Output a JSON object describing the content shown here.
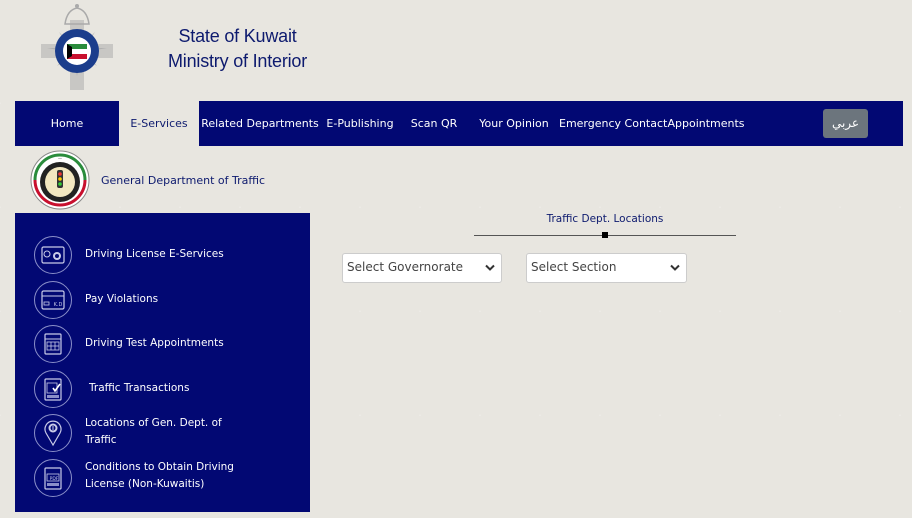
{
  "header": {
    "logo_alt": "Kuwait Police",
    "title_line1": "State of Kuwait",
    "title_line2": "Ministry of Interior"
  },
  "nav": {
    "items": [
      {
        "label": "Home",
        "active": false
      },
      {
        "label": "E-Services",
        "active": true
      },
      {
        "label": "Related Departments",
        "active": false
      },
      {
        "label": "E-Publishing",
        "active": false
      },
      {
        "label": "Scan QR",
        "active": false
      },
      {
        "label": "Your Opinion",
        "active": false
      },
      {
        "label": "Emergency Contact",
        "active": false
      },
      {
        "label": "Appointments",
        "active": false
      }
    ],
    "language_button": "عربي"
  },
  "department": {
    "title": "General Department of Traffic"
  },
  "sidebar": {
    "items": [
      {
        "label": "Driving License E-Services",
        "icon": "license-card-icon"
      },
      {
        "label": "Pay Violations",
        "icon": "payment-card-icon"
      },
      {
        "label": "Driving Test Appointments",
        "icon": "calendar-icon"
      },
      {
        "label": "Traffic Transactions",
        "icon": "clipboard-check-icon"
      },
      {
        "label": "Locations of Gen. Dept. of Traffic",
        "icon": "location-pin-icon"
      },
      {
        "label": "Conditions to Obtain Driving License (Non-Kuwaitis)",
        "icon": "pdf-document-icon"
      }
    ]
  },
  "main": {
    "section_title": "Traffic Dept. Locations",
    "governorate_select": {
      "value": "Select Governorate"
    },
    "section_select": {
      "value": "Select Section"
    }
  },
  "colors": {
    "navy": "#020873",
    "background": "#e8e6e0",
    "language_button": "#6c757d"
  }
}
